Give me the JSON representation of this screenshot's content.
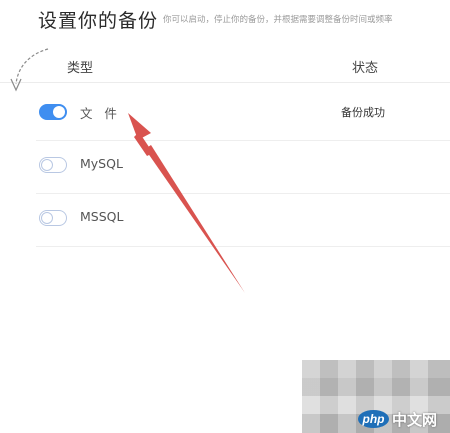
{
  "header": {
    "title": "设置你的备份",
    "subtitle": "你可以启动，停止你的备份，并根据需要调整备份时间或频率"
  },
  "table": {
    "columns": {
      "type": "类型",
      "status": "状态"
    },
    "rows": [
      {
        "label": "文   件",
        "enabled": true,
        "status": "备份成功"
      },
      {
        "label": "MySQL",
        "enabled": false,
        "status": ""
      },
      {
        "label": "MSSQL",
        "enabled": false,
        "status": ""
      }
    ]
  },
  "annotation": {
    "arrow_color": "#d9534f",
    "curve_color": "#8a8a8a"
  },
  "watermark": {
    "logo": "php",
    "site": "中文网"
  },
  "icons": {
    "annotation_arrow": "red-arrow-icon",
    "annotation_curve": "curved-arrow-icon",
    "watermark_logo": "php-logo-icon"
  }
}
